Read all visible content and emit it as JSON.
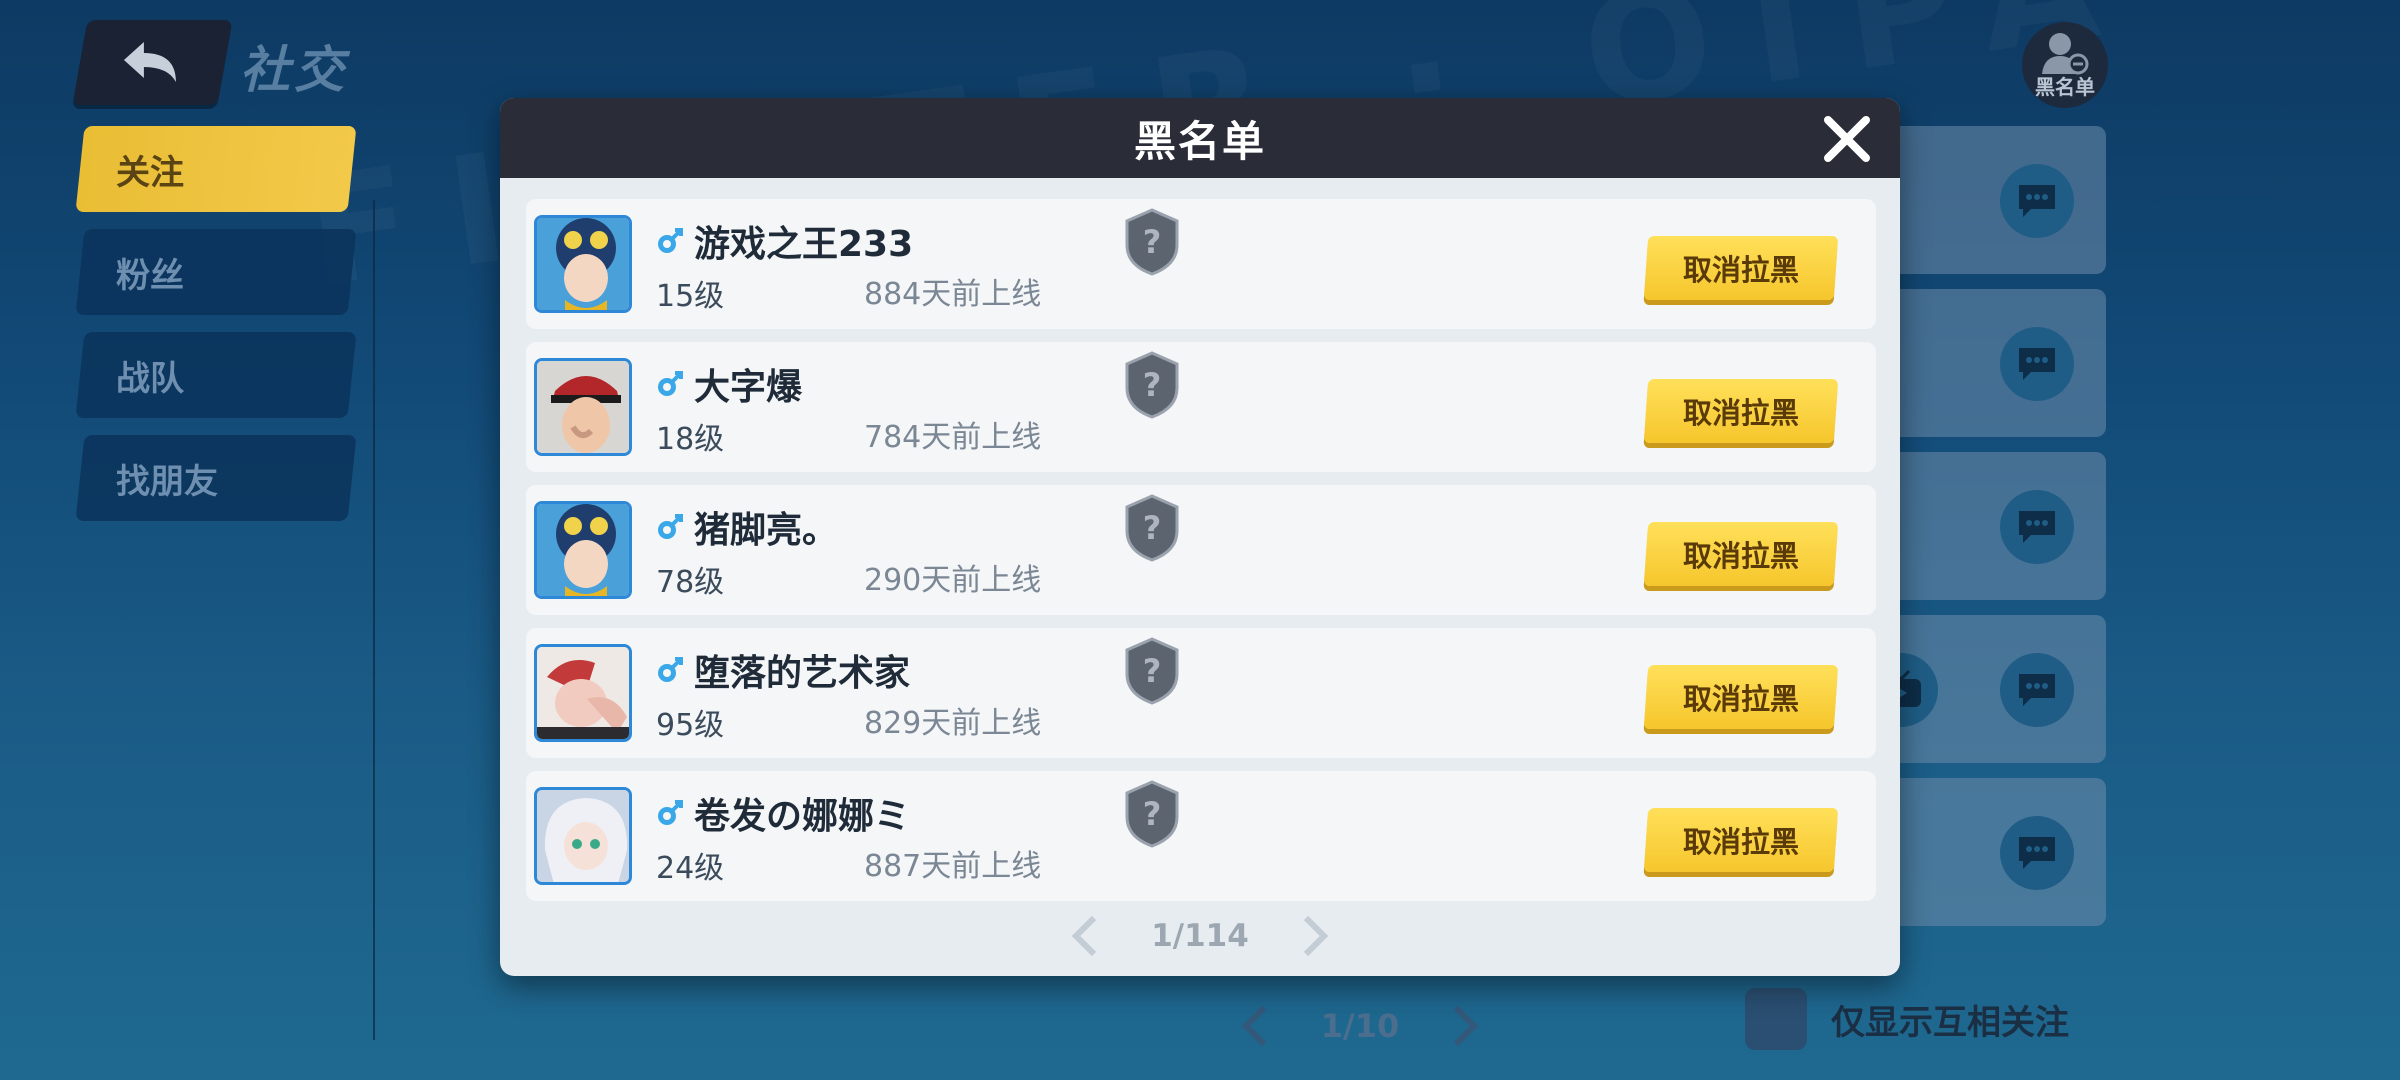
{
  "page": {
    "title": "社交",
    "side_tabs": [
      {
        "label": "关注",
        "active": true
      },
      {
        "label": "粉丝",
        "active": false
      },
      {
        "label": "战队",
        "active": false
      },
      {
        "label": "找朋友",
        "active": false
      }
    ],
    "blacklist_button_label": "黑名单",
    "bg_pagination": "1/10",
    "mutual_only_label": "仅显示互相关注"
  },
  "modal": {
    "title": "黑名单",
    "pagination": "1/114",
    "unblock_label": "取消拉黑",
    "rows": [
      {
        "name": "游戏之王233",
        "gender_icon": "male-icon",
        "level": "15级",
        "last_online": "884天前上线"
      },
      {
        "name": "大字爆",
        "gender_icon": "male-icon",
        "level": "18级",
        "last_online": "784天前上线"
      },
      {
        "name": "猪脚亮。",
        "gender_icon": "male-icon",
        "level": "78级",
        "last_online": "290天前上线"
      },
      {
        "name": "堕落的艺术家",
        "gender_icon": "male-icon",
        "level": "95级",
        "last_online": "829天前上线"
      },
      {
        "name": "卷发の娜娜ミ",
        "gender_icon": "male-icon",
        "level": "24级",
        "last_online": "887天前上线"
      }
    ]
  },
  "colors": {
    "accent_yellow": "#f6c62c",
    "modal_header": "#2a2d38",
    "male_blue": "#3aa7e8"
  }
}
